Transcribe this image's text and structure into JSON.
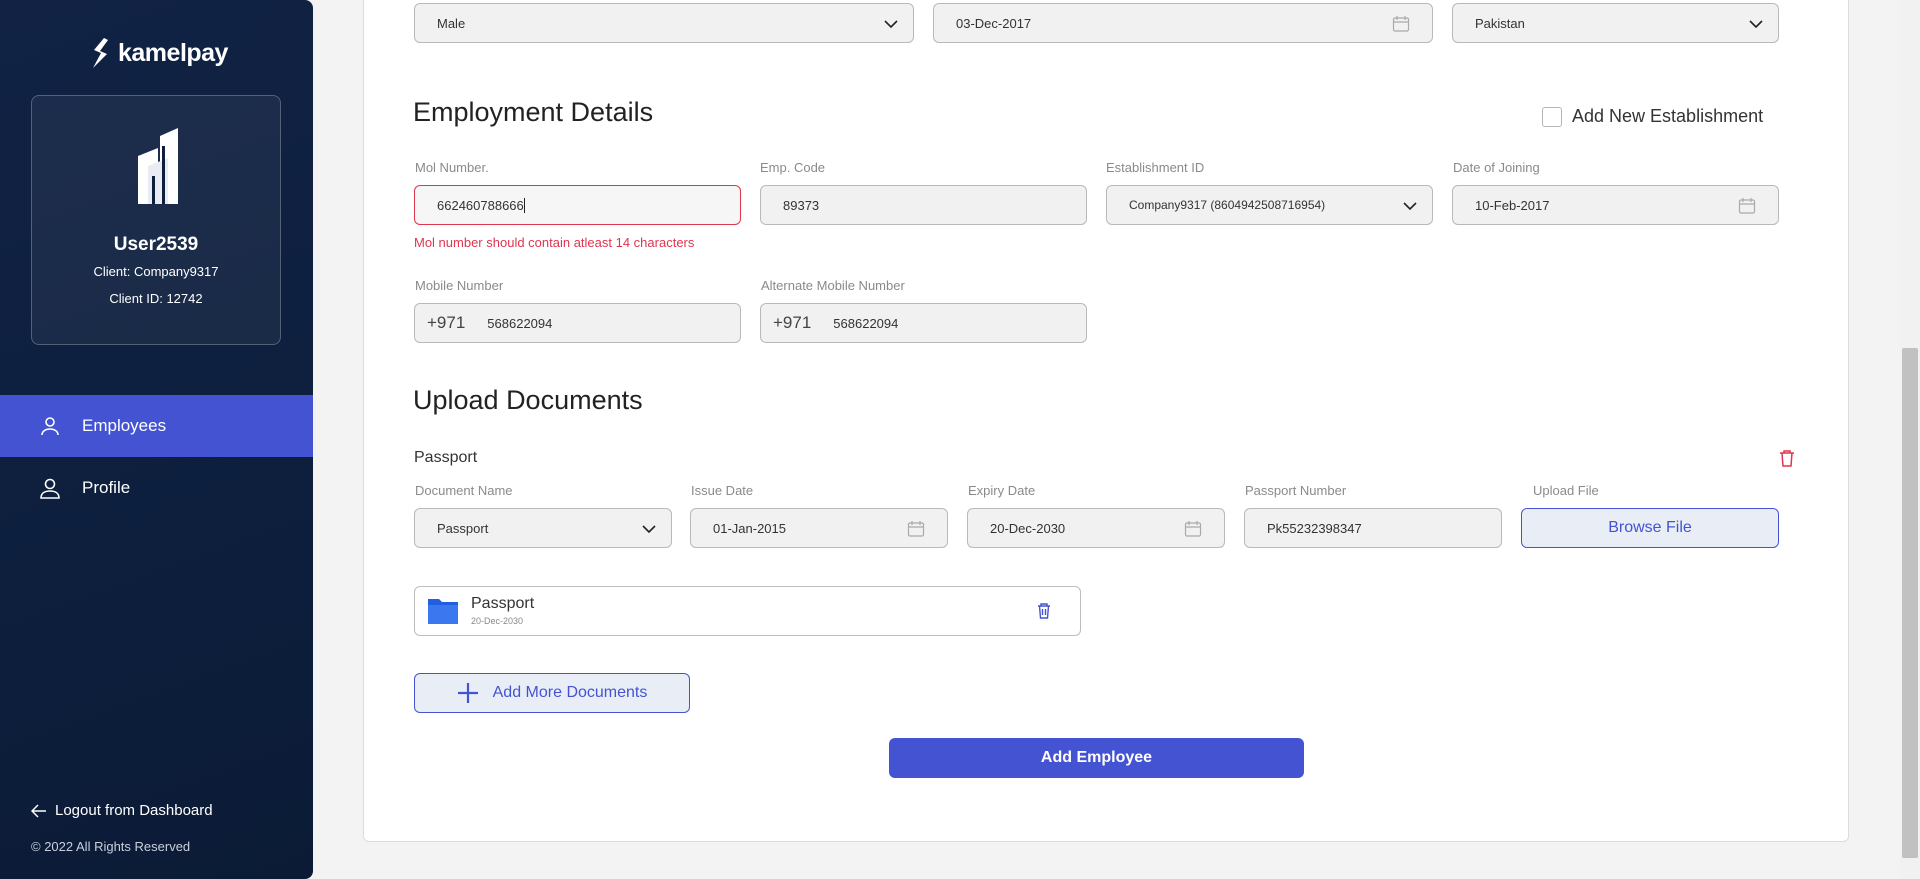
{
  "sidebar": {
    "brand": "kamelpay",
    "user_name": "User2539",
    "client": "Client: Company9317",
    "client_id": "Client ID: 12742",
    "nav": [
      {
        "label": "Employees",
        "icon": "user-icon",
        "active": true
      },
      {
        "label": "Profile",
        "icon": "user-icon",
        "active": false
      }
    ],
    "logout_label": "Logout from Dashboard",
    "copyright": "© 2022 All Rights Reserved"
  },
  "top_row": {
    "gender": "Male",
    "dob": "03-Dec-2017",
    "nationality": "Pakistan"
  },
  "employment": {
    "title": "Employment Details",
    "add_establishment_label": "Add New Establishment",
    "mol_label": "Mol Number.",
    "mol_value": "662460788666",
    "mol_error": "Mol number should contain atleast 14 characters",
    "emp_code_label": "Emp. Code",
    "emp_code_value": "89373",
    "establishment_label": "Establishment ID",
    "establishment_value": "Company9317 (8604942508716954)",
    "joining_label": "Date of Joining",
    "joining_value": "10-Feb-2017",
    "mobile_label": "Mobile Number",
    "mobile_prefix": "+971",
    "mobile_value": "568622094",
    "alt_mobile_label": "Alternate Mobile Number",
    "alt_mobile_prefix": "+971",
    "alt_mobile_value": "568622094"
  },
  "documents": {
    "title": "Upload Documents",
    "doc_heading": "Passport",
    "doc_name_label": "Document Name",
    "doc_name_value": "Passport",
    "issue_label": "Issue Date",
    "issue_value": "01-Jan-2015",
    "expiry_label": "Expiry Date",
    "expiry_value": "20-Dec-2030",
    "passport_label": "Passport Number",
    "passport_value": "Pk55232398347",
    "upload_label": "Upload File",
    "browse_label": "Browse File",
    "file_name": "Passport",
    "file_date": "20-Dec-2030",
    "add_more_label": "Add More Documents"
  },
  "submit_label": "Add Employee",
  "colors": {
    "sidebar_bg": "#0d1f3d",
    "accent": "#4453d2",
    "error": "#e0354e"
  }
}
